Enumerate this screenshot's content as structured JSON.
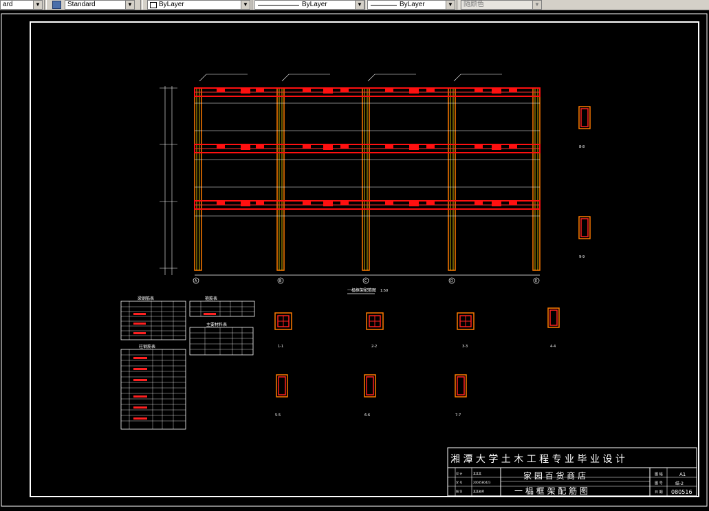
{
  "toolbar": {
    "text_style_partial": "ard",
    "dim_style": "Standard",
    "layer": "ByLayer",
    "linetype": "ByLayer",
    "lineweight": "ByLayer",
    "plot_style": "随颜色"
  },
  "title_block": {
    "header": "湘 潭 大 学 土 木 工 程 专 业 毕 业 设 计",
    "project": "家 园 百 货 商 店",
    "drawing": "一 榀 框 架 配 筋 图",
    "size_label": "图 幅",
    "size_value": "A1",
    "number_label": "图 号",
    "number_value": "结-2",
    "date_label": "日 期",
    "date_value": "080516",
    "row_labels": [
      "设 计",
      "学 号",
      "指 导"
    ],
    "row_values": [
      "某某某",
      "2004580423",
      "某某老师"
    ]
  },
  "drawing": {
    "frame_title": "一榀框架配筋图",
    "frame_scale": "1:50",
    "table1_title": "梁钢筋表",
    "table2_title": "柱钢筋表",
    "table3_title": "箍筋表",
    "table4_title": "主要材料表",
    "axis_labels": [
      "A",
      "B",
      "C",
      "D",
      "E"
    ],
    "section_labels": [
      "1-1",
      "2-2",
      "3-3",
      "4-4",
      "5-5",
      "6-6",
      "7-7",
      "8-8",
      "9-9"
    ]
  }
}
